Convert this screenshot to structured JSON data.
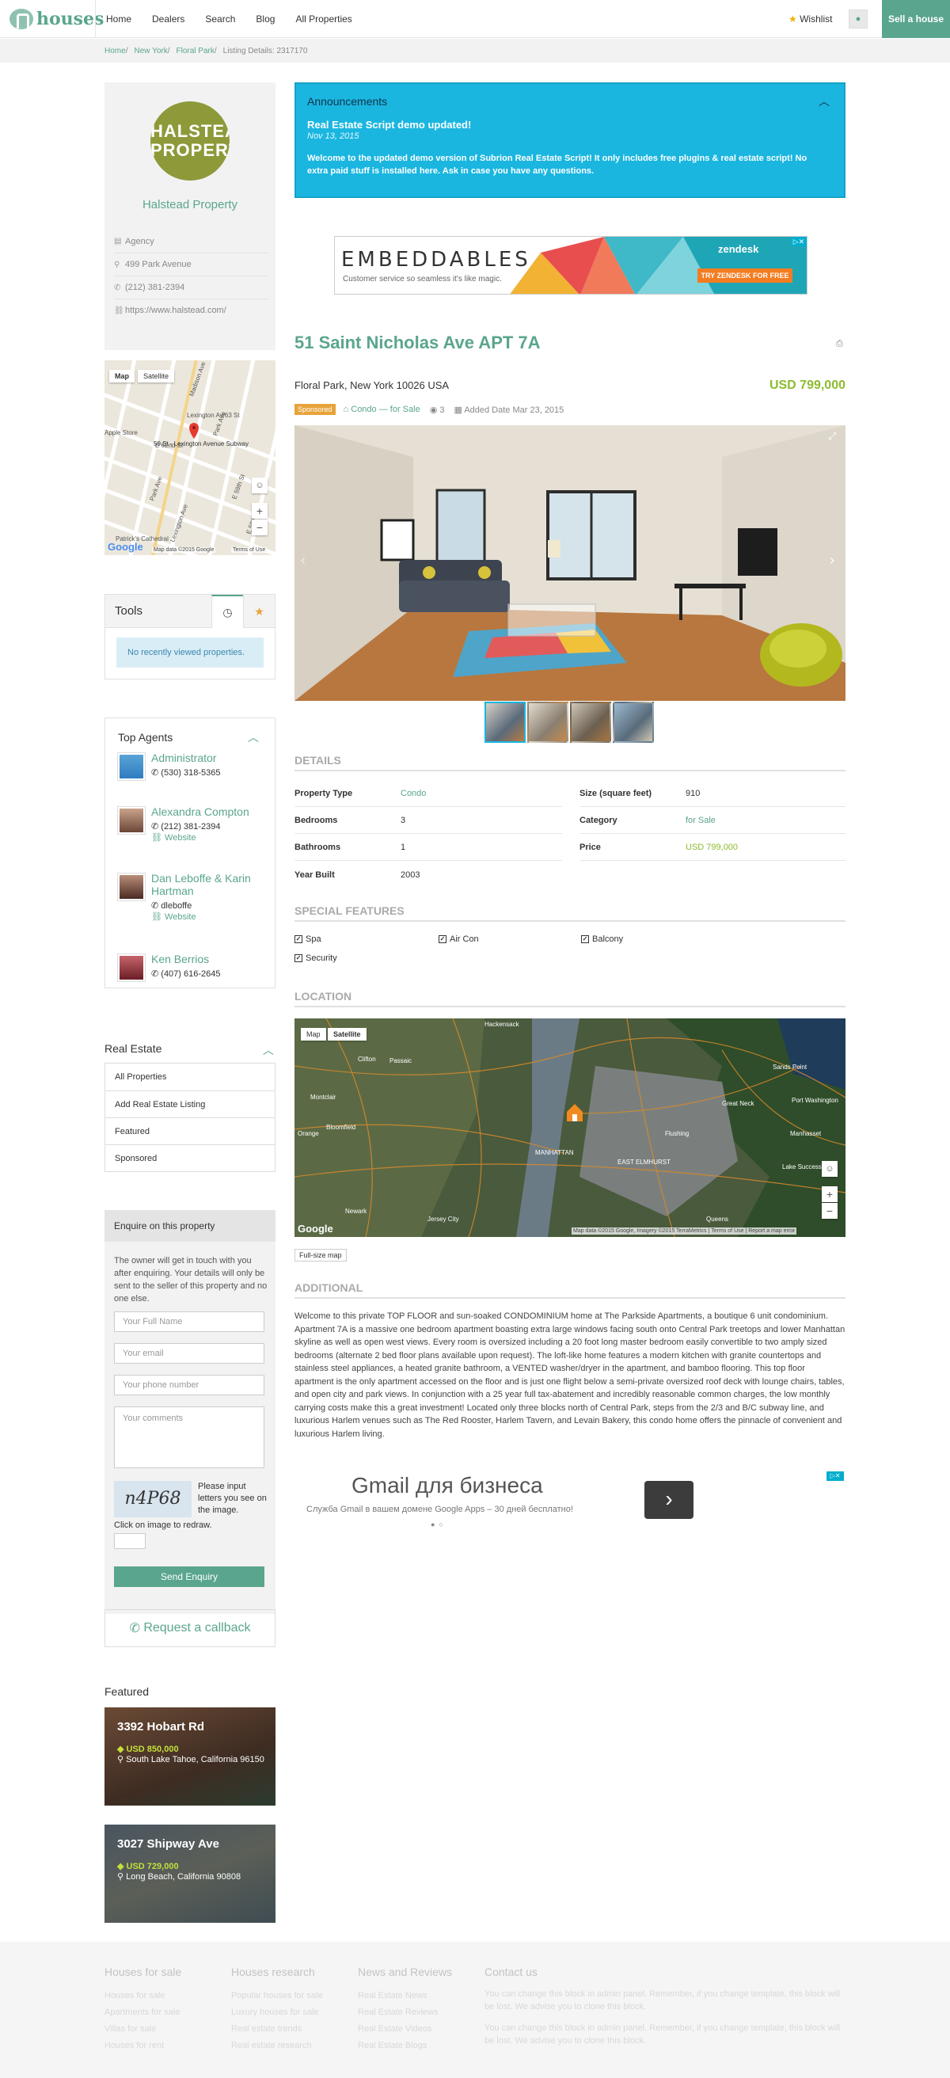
{
  "header": {
    "logo_text": "houses",
    "nav": [
      "Home",
      "Dealers",
      "Search",
      "Blog",
      "All Properties"
    ],
    "wishlist_label": "Wishlist",
    "sell_label": "Sell a house"
  },
  "breadcrumb": [
    "Home",
    "New York",
    "Floral Park",
    "Listing Details: 2317170"
  ],
  "agency": {
    "logo_text": "HALSTEAD PROPERTY",
    "name": "Halstead Property",
    "type": "Agency",
    "address": "499 Park Avenue",
    "phone": "(212) 381-2394",
    "website": "https://www.halstead.com/"
  },
  "mini_map": {
    "tab_map": "Map",
    "tab_satellite": "Satellite",
    "streets": [
      "Madison Ave",
      "Lexington Av/63 St",
      "Park Ave",
      "E 59th St",
      "E 58th St",
      "E 57th St",
      "E 60th St",
      "E 61st St",
      "E 62nd St",
      "Park Ave",
      "Lexington Ave",
      "3rd Ave"
    ],
    "poi": [
      "Apple Store",
      "59 St - Lexington Avenue Subway",
      "Patrick's Cathedral"
    ],
    "attribution": "Map data ©2015 Google",
    "terms": "Terms of Use"
  },
  "tools": {
    "title": "Tools",
    "empty_message": "No recently viewed properties."
  },
  "top_agents": {
    "title": "Top Agents",
    "agents": [
      {
        "name": "Administrator",
        "lines": [
          "(530) 318-5365"
        ]
      },
      {
        "name": "Alexandra Compton",
        "lines": [
          "(212) 381-2394",
          "Website"
        ]
      },
      {
        "name": "Dan Leboffe & Karin Hartman",
        "lines": [
          "dleboffe",
          "Website"
        ]
      },
      {
        "name": "Ken Berrios",
        "lines": [
          "(407) 616-2645"
        ]
      }
    ]
  },
  "real_estate": {
    "title": "Real Estate",
    "items": [
      "All Properties",
      "Add Real Estate Listing",
      "Featured",
      "Sponsored"
    ]
  },
  "enquire": {
    "title": "Enquire on this property",
    "text": "The owner will get in touch with you after enquiring. Your details will only be sent to the seller of this property and no one else.",
    "name_placeholder": "Your Full Name",
    "email_placeholder": "Your email",
    "phone_placeholder": "Your phone number",
    "comments_placeholder": "Your comments",
    "captcha_text": "n4P68",
    "captcha_prompt": "Please input letters you see on the image.",
    "captcha_redraw": "Click on image to redraw.",
    "submit_label": "Send Enquiry"
  },
  "callback_label": "Request a callback",
  "featured": {
    "title": "Featured",
    "items": [
      {
        "name": "3392 Hobart Rd",
        "price": "USD 850,000",
        "address": "South Lake Tahoe, California 96150"
      },
      {
        "name": "3027 Shipway Ave",
        "price": "USD 729,000",
        "address": "Long Beach, California 90808"
      }
    ]
  },
  "announcements": {
    "title": "Announcements",
    "headline": "Real Estate Script demo updated!",
    "date": "Nov 13, 2015",
    "body": "Welcome to the updated demo version of Subrion Real Estate Script! It only includes free plugins & real estate script! No extra paid stuff is installed here. Ask in case you have any questions."
  },
  "ad_top": {
    "headline": "EMBEDDABLES",
    "tagline": "Customer service so seamless it's like magic.",
    "brand": "zendesk",
    "cta": "TRY ZENDESK FOR FREE"
  },
  "listing": {
    "title": "51 Saint Nicholas Ave APT 7A",
    "location": "Floral Park, New York 10026 USA",
    "price": "USD 799,000",
    "badge": "Sponsored",
    "category_link": "Condo — for Sale",
    "views": "3",
    "added": "Added Date Mar 23, 2015",
    "photo_index": 0,
    "thumb_count": 4
  },
  "details": {
    "heading": "DETAILS",
    "left": [
      {
        "label": "Property Type",
        "value": "Condo",
        "link": true
      },
      {
        "label": "Bedrooms",
        "value": "3"
      },
      {
        "label": "Bathrooms",
        "value": "1"
      },
      {
        "label": "Year Built",
        "value": "2003"
      }
    ],
    "right": [
      {
        "label": "Size (square feet)",
        "value": "910"
      },
      {
        "label": "Category",
        "value": "for Sale",
        "link": true
      },
      {
        "label": "Price",
        "value": "USD 799,000",
        "price": true
      }
    ]
  },
  "special_features": {
    "heading": "SPECIAL FEATURES",
    "items": [
      "Spa",
      "Air Con",
      "Balcony",
      "Security"
    ]
  },
  "location_map": {
    "heading": "LOCATION",
    "tab_map": "Map",
    "tab_satellite": "Satellite",
    "places": [
      "Hackensack",
      "Clifton",
      "Passaic",
      "Montclair",
      "Bloomfield",
      "Orange",
      "Newark",
      "Jersey City",
      "MANHATTAN",
      "Flushing",
      "Queens",
      "EAST ELMHURST",
      "Sands Point",
      "Port Washington",
      "Manhasset",
      "Lake Success",
      "Great Neck"
    ],
    "attribution": "Map data ©2015 Google, Imagery ©2015 TerraMetrics",
    "terms": "Terms of Use",
    "report": "Report a map error",
    "full_size_label": "Full-size map"
  },
  "additional": {
    "heading": "ADDITIONAL",
    "text": "Welcome to this private TOP FLOOR and sun-soaked CONDOMINIUM home at The Parkside Apartments, a boutique 6 unit condominium. Apartment 7A is a massive one bedroom apartment boasting extra large windows facing south onto Central Park treetops and lower Manhattan skyline as well as open west views. Every room is oversized including a 20 foot long master bedroom easily convertible to two amply sized bedrooms (alternate 2 bed floor plans available upon request). The loft-like home features a modern kitchen with granite countertops and stainless steel appliances, a heated granite bathroom, a VENTED washer/dryer in the apartment, and bamboo flooring. This top floor apartment is the only apartment accessed on the floor and is just one flight below a semi-private oversized roof deck with lounge chairs, tables, and open city and park views. In conjunction with a 25 year full tax-abatement and incredibly reasonable common charges, the low monthly carrying costs make this a great investment! Located only three blocks north of Central Park, steps from the 2/3 and B/C subway line, and luxurious Harlem venues such as The Red Rooster, Harlem Tavern, and Levain Bakery, this condo home offers the pinnacle of convenient and luxurious Harlem living."
  },
  "ad_bottom": {
    "headline": "Gmail для бизнеса",
    "subline": "Служба Gmail в вашем домене Google Apps – 30 дней бесплатно!"
  },
  "footer": {
    "columns": [
      {
        "title": "Houses for sale",
        "items": [
          "Houses for sale",
          "Apartments for sale",
          "Villas for sale",
          "Houses for rent"
        ]
      },
      {
        "title": "Houses research",
        "items": [
          "Popular houses for sale",
          "Luxury houses for sale",
          "Real estate trends",
          "Real estate research"
        ]
      },
      {
        "title": "News and Reviews",
        "items": [
          "Real Estate News",
          "Real Estate Reviews",
          "Real Estate Videos",
          "Real Estate Blogs"
        ]
      },
      {
        "title": "Contact us",
        "items": [
          "You can change this block in admin panel. Remember, if you change template, this block will be lost. We advise you to clone this block.",
          "You can change this block in admin panel. Remember, if you change template, this block will be lost. We advise you to clone this block."
        ]
      }
    ]
  },
  "colors": {
    "accent": "#5aa58e",
    "announcement": "#1ab6e0",
    "price": "#8dbb2e",
    "sponsored": "#e8a33a"
  }
}
